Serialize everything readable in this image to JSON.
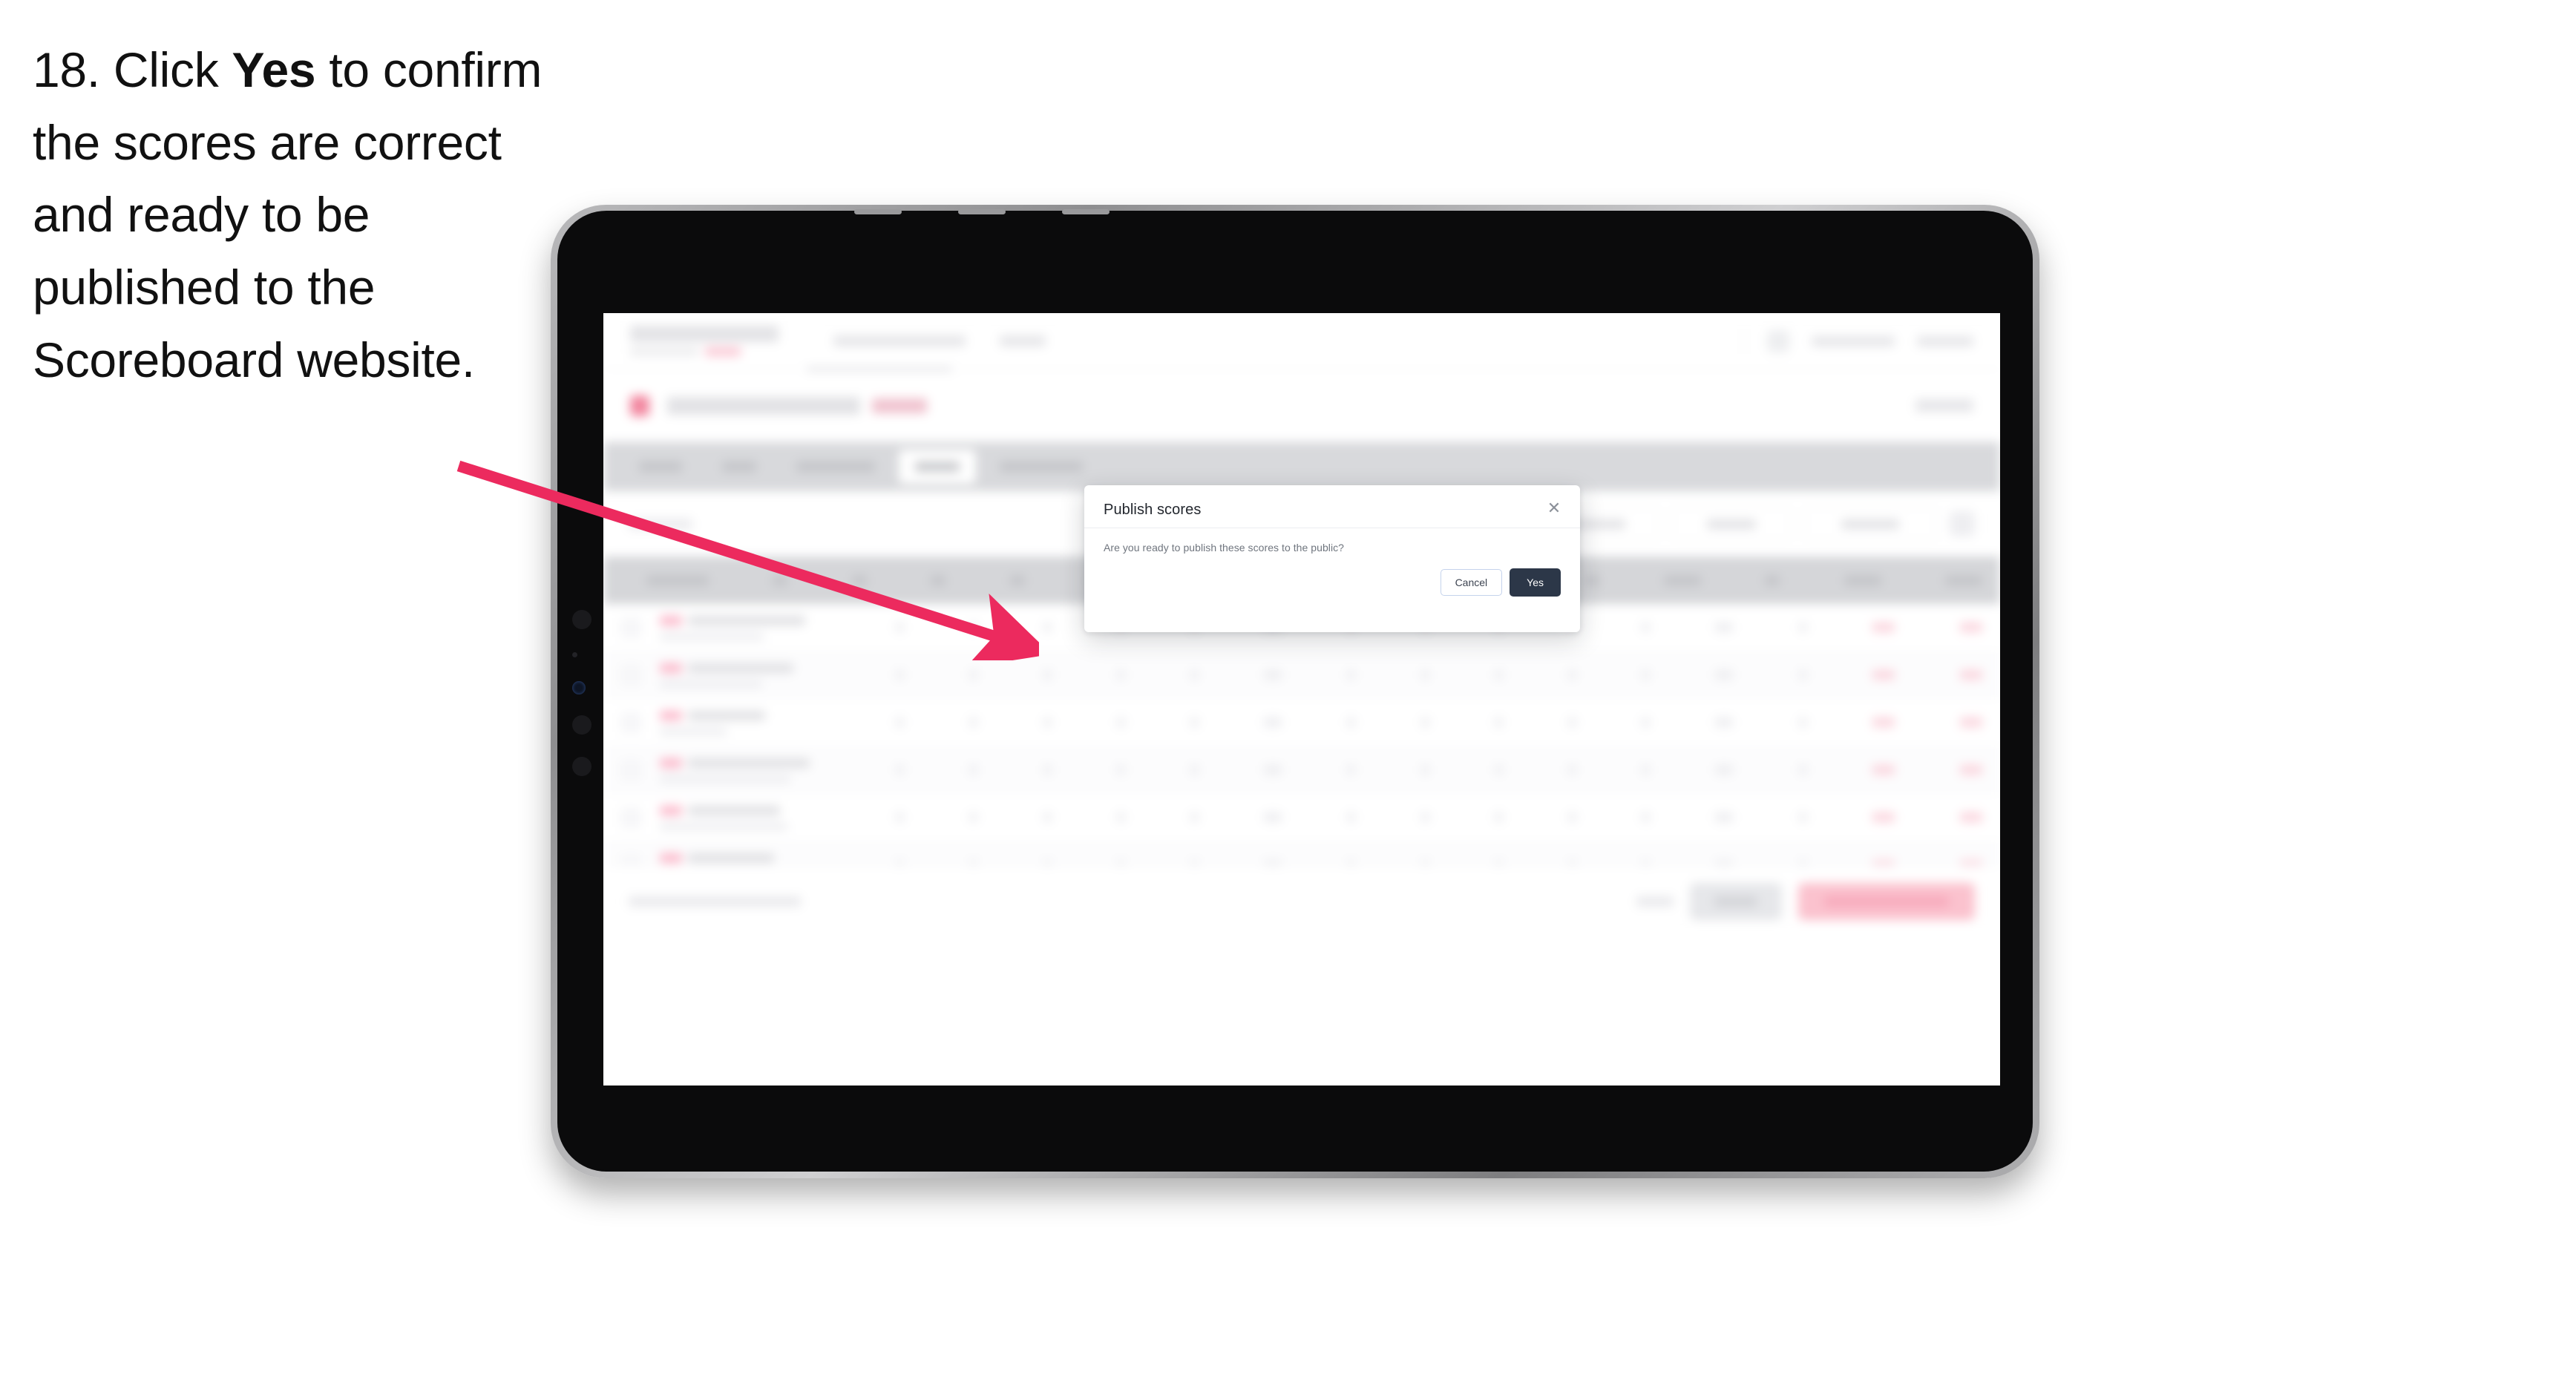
{
  "instruction": {
    "step_number": "18.",
    "before_bold": "Click ",
    "bold_word": "Yes",
    "after_bold": " to confirm the scores are correct and ready to be published to the Scoreboard website."
  },
  "modal": {
    "title": "Publish scores",
    "body_text": "Are you ready to publish these scores to the public?",
    "close_icon": "close-x-icon",
    "cancel_label": "Cancel",
    "confirm_label": "Yes"
  },
  "colors": {
    "arrow": "#EC2A5E",
    "confirm_button_bg": "#2C3748",
    "confirm_button_text": "#FFFFFF",
    "cancel_button_border": "#C5D3EC",
    "modal_title_text": "#23272E",
    "modal_body_text": "#6F757E",
    "device_bezel": "#0B0B0C",
    "device_frame": "#9A9A9C",
    "tab_bar_bg": "#D8D9DC",
    "table_header_bg": "#D5D6D9",
    "accent_pink": "#FBC2CE"
  },
  "device": {
    "type": "tablet",
    "orientation": "landscape"
  },
  "background_app": {
    "obscured": true,
    "blur_note": "Application behind the dialog is blurred out and unreadable",
    "tab_count": 5,
    "active_tab_index": 3,
    "table_row_count": 7,
    "filter_button_count": 3,
    "bottom_button_count": 2
  }
}
